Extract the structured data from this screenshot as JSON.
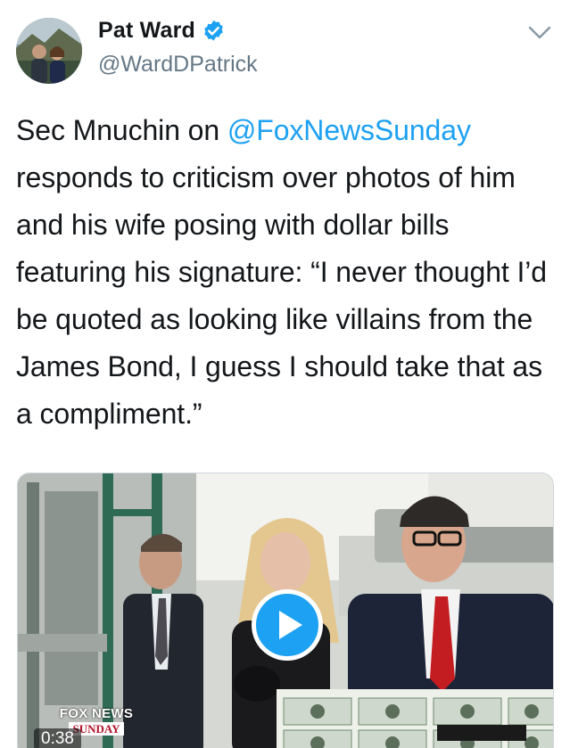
{
  "user": {
    "display_name": "Pat Ward",
    "handle": "@WardDPatrick",
    "verified": true
  },
  "tweet": {
    "text_before_mention": "Sec Mnuchin on ",
    "mention": "@FoxNewsSunday",
    "text_after_mention": " responds to criticism over photos of him and his wife posing with dollar bills featuring his signature: “I never thought I’d be quoted as looking like villains from the James Bond, I guess I should take that as a compliment.”"
  },
  "media": {
    "type": "video",
    "duration": "0:38",
    "logo_line1": "FOX NEWS",
    "logo_line2": "SUNDAY"
  },
  "colors": {
    "accent": "#1da1f2",
    "text": "#14171a",
    "secondary": "#657786"
  },
  "icons": {
    "menu": "chevron-down-icon",
    "verified": "verified-badge-icon",
    "play": "play-icon"
  }
}
